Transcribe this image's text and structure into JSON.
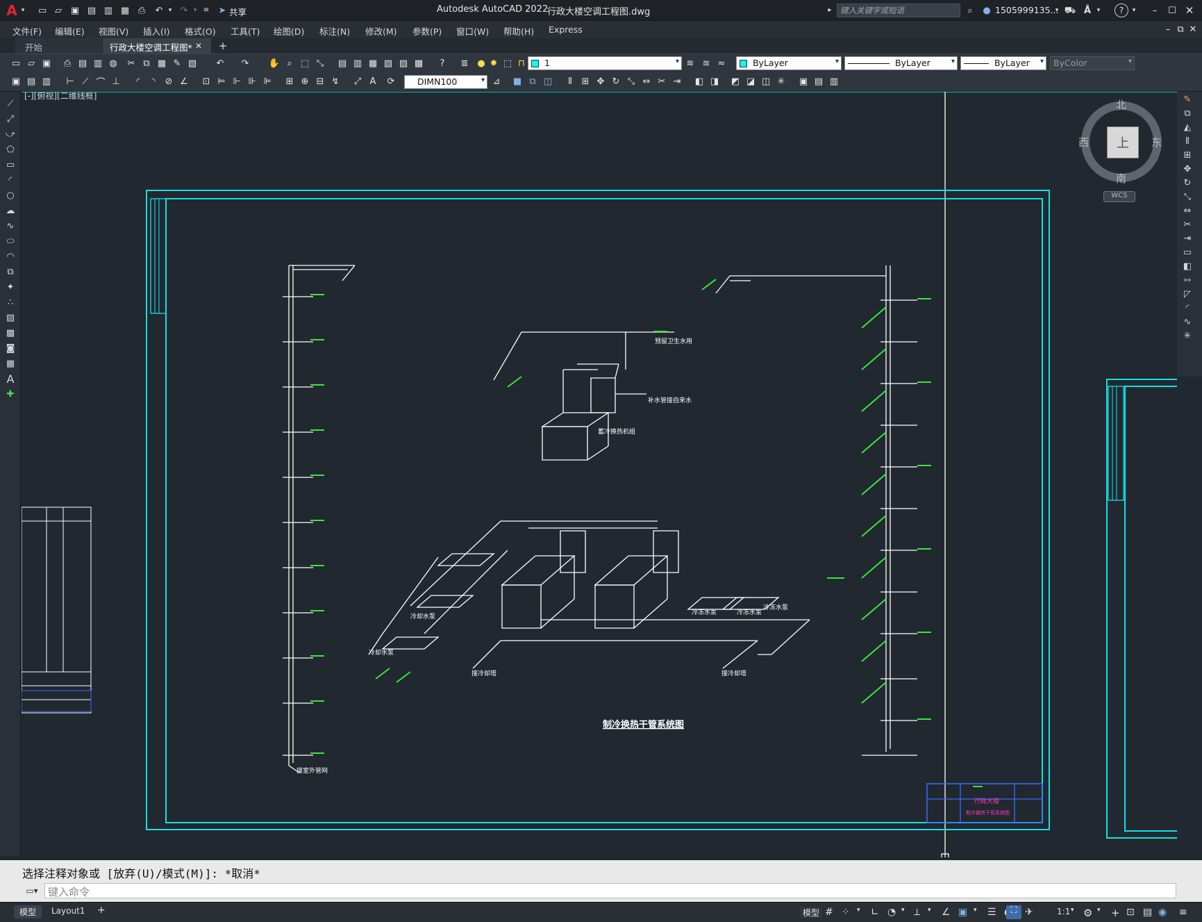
{
  "titlebar": {
    "app_title": "Autodesk AutoCAD 2022",
    "file_name": "行政大楼空调工程图.dwg",
    "share_label": "共享",
    "search_placeholder": "键入关键字或短语",
    "user_name": "1505999135..."
  },
  "menu": {
    "items": [
      "文件(F)",
      "编辑(E)",
      "视图(V)",
      "插入(I)",
      "格式(O)",
      "工具(T)",
      "绘图(D)",
      "标注(N)",
      "修改(M)",
      "参数(P)",
      "窗口(W)",
      "帮助(H)",
      "Express"
    ]
  },
  "tabs": {
    "start": "开始",
    "active": "行政大楼空调工程图*",
    "add": "+"
  },
  "toolbar": {
    "layer_value": "1",
    "color_value": "ByLayer",
    "linetype_value": "ByLayer",
    "lineweight_value": "ByLayer",
    "plotstyle_value": "ByColor",
    "dimstyle_value": "DIMN100"
  },
  "viewport": {
    "label": "[-][俯视][二维线框]"
  },
  "viewcube": {
    "north": "北",
    "south": "南",
    "east": "东",
    "west": "西",
    "top_face": "上",
    "wcs": "WCS"
  },
  "drawing": {
    "title": "制冷换热干管系统图",
    "labels": {
      "domestic_water": "预留卫生水用",
      "tap_water": "补水管接自来水",
      "heat_pump": "蓄冷换热机组",
      "cooling_pump_1": "冷冻水泵",
      "cooling_pump_2": "冷冻水泵",
      "cooling_pump_3": "冷冻水泵",
      "chilled_pump_1": "冷却水泵",
      "chilled_pump_2": "冷却水泵",
      "to_tower_1": "接冷却塔",
      "to_tower_2": "接冷却塔",
      "outdoor_pipe": "接室外管网"
    },
    "titleblock": {
      "project": "行政大楼",
      "sheet": "制冷换热干管系统图"
    }
  },
  "commandline": {
    "history": "选择注释对象或 [放弃(U)/模式(M)]: *取消*",
    "placeholder": "键入命令"
  },
  "statusbar": {
    "layout_tabs": [
      "模型",
      "Layout1"
    ],
    "add": "+",
    "model_label": "模型",
    "scale": "1:1"
  }
}
